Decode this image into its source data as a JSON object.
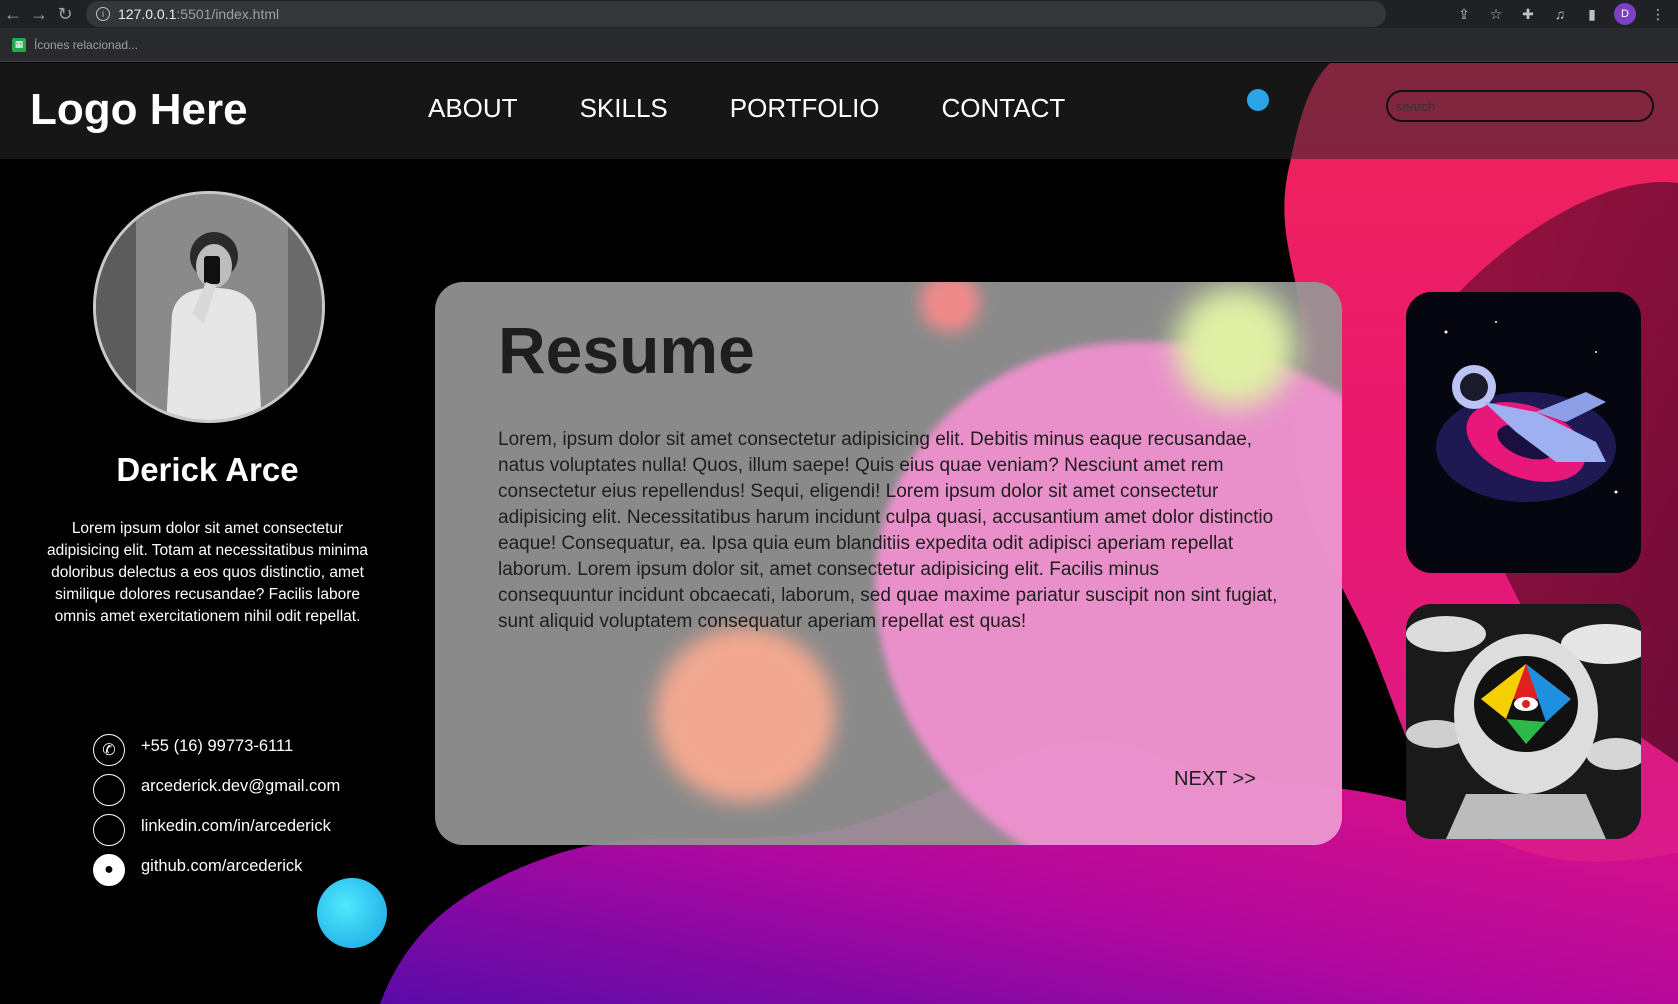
{
  "browser": {
    "url_host": "127.0.0.1",
    "url_rest": ":5501/index.html",
    "bookmark": "Ícones relacionad...",
    "profile_initial": "D"
  },
  "header": {
    "logo": "Logo Here",
    "nav": [
      "ABOUT",
      "SKILLS",
      "PORTFOLIO",
      "CONTACT"
    ],
    "search_placeholder": "search"
  },
  "profile": {
    "name": "Derick Arce",
    "bio": "Lorem ipsum dolor sit amet consectetur adipisicing elit. Totam at necessitatibus minima doloribus delectus a eos quos distinctio, amet similique dolores recusandae? Facilis labore omnis amet exercitationem nihil odit repellat.",
    "contacts": [
      {
        "icon": "phone-icon",
        "text": "+55 (16) 99773-6111"
      },
      {
        "icon": "email-icon",
        "text": "arcederick.dev@gmail.com"
      },
      {
        "icon": "linkedin-icon",
        "text": "linkedin.com/in/arcederick"
      },
      {
        "icon": "github-icon",
        "text": "github.com/arcederick"
      }
    ]
  },
  "card": {
    "title": "Resume",
    "body": "Lorem, ipsum dolor sit amet consectetur adipisicing elit. Debitis minus eaque recusandae, natus voluptates nulla! Quos, illum saepe! Quis eius quae veniam? Nesciunt amet rem consectetur eius repellendus! Sequi, eligendi! Lorem ipsum dolor sit amet consectetur adipisicing elit. Necessitatibus harum incidunt culpa quasi, accusantium amet dolor distinctio eaque! Consequatur, ea. Ipsa quia eum blanditiis expedita odit adipisci aperiam repellat laborum. Lorem ipsum dolor sit, amet consectetur adipisicing elit. Facilis minus consequuntur incidunt obcaecati, laborum, sed quae maxime pariatur suscipit non sint fugiat, sunt aliquid voluptatem consequatur aperiam repellat est quas!",
    "next": "NEXT >>"
  },
  "colors": {
    "accent_pink": "#e8186f",
    "accent_purple": "#6a0aa8",
    "accent_cyan": "#2fd0f5"
  }
}
